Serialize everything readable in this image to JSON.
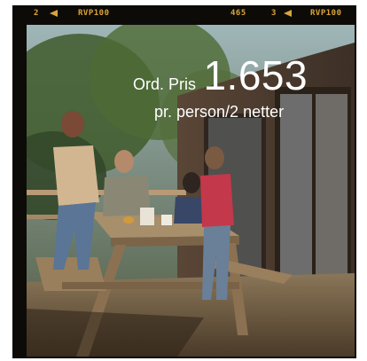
{
  "film_strip": {
    "left_frame_number": "2",
    "left_film_type": "RVP100",
    "edge_code": "465",
    "right_frame_number": "3",
    "right_film_type": "RVP100"
  },
  "offer": {
    "label": "Ord. Pris",
    "price": "1.653",
    "subtitle": "pr. person/2 netter"
  }
}
